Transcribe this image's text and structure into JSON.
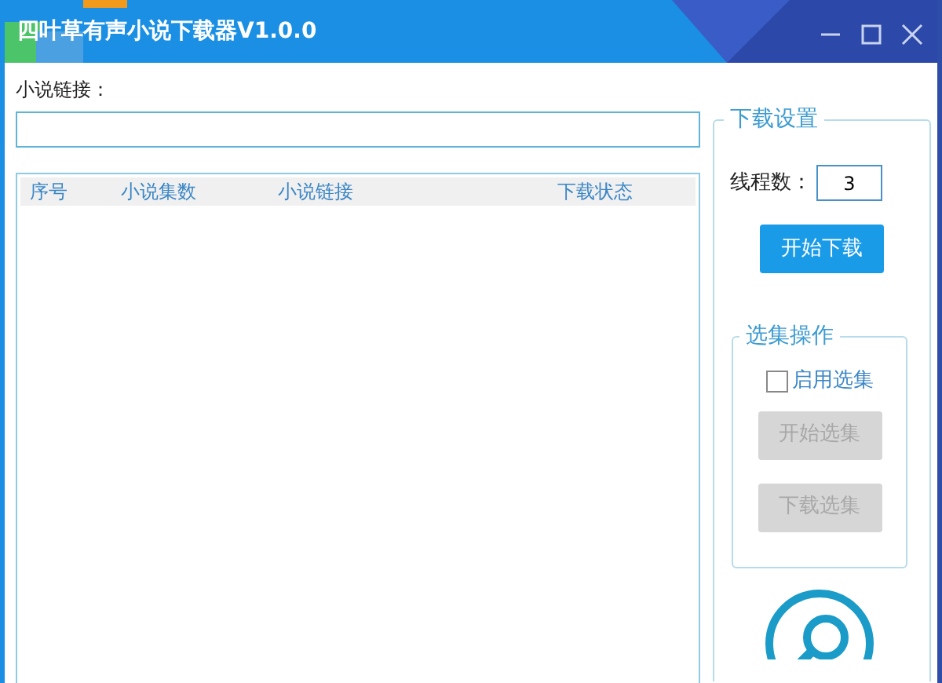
{
  "window": {
    "title": "四叶草有声小说下载器V1.0.0"
  },
  "link_field": {
    "label": "小说链接："
  },
  "table": {
    "columns": [
      "序号",
      "小说集数",
      "小说链接",
      "下载状态"
    ]
  },
  "download_settings": {
    "title": "下载设置",
    "thread_label": "线程数：",
    "thread_value": "3",
    "start_button": {
      "label": "开始下载",
      "disabled": false
    }
  },
  "episode_operations": {
    "title": "选集操作",
    "enable_checkbox": {
      "label": "启用选集",
      "checked": false
    },
    "buttons": [
      {
        "label": "开始选集",
        "disabled": true
      },
      {
        "label": "下载选集",
        "disabled": true
      }
    ]
  }
}
